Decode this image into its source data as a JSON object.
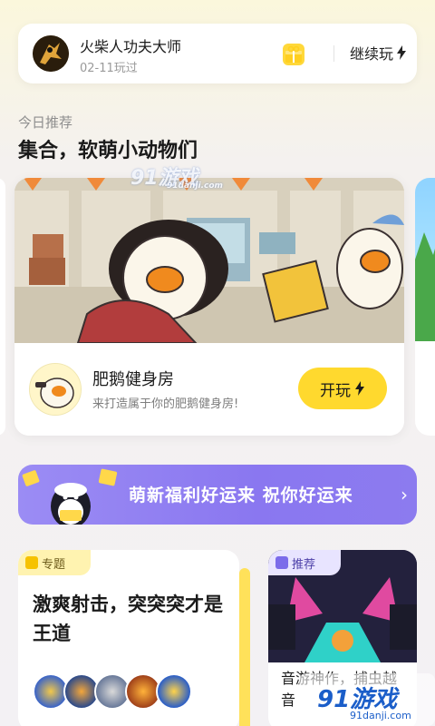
{
  "recent": {
    "title": "火柴人功夫大师",
    "date": "02-11玩过",
    "continue_label": "继续玩"
  },
  "recommend": {
    "label": "今日推荐",
    "title": "集合，软萌小动物们"
  },
  "featured_game": {
    "name": "肥鹅健身房",
    "desc": "来打造属于你的肥鹅健身房!",
    "play_label": "开玩"
  },
  "promo": {
    "text": "萌新福利好运来 祝你好运来"
  },
  "topic_card": {
    "tag": "专题",
    "title": "激爽射击，突突突才是王道"
  },
  "rec_card": {
    "tag": "推荐",
    "title": "音游神作，捕虫越音"
  },
  "watermark": {
    "brand": "91游戏",
    "domain": "91danji.com"
  },
  "colors": {
    "accent_yellow": "#ffd92e",
    "promo_purple": "#8a77f0"
  }
}
